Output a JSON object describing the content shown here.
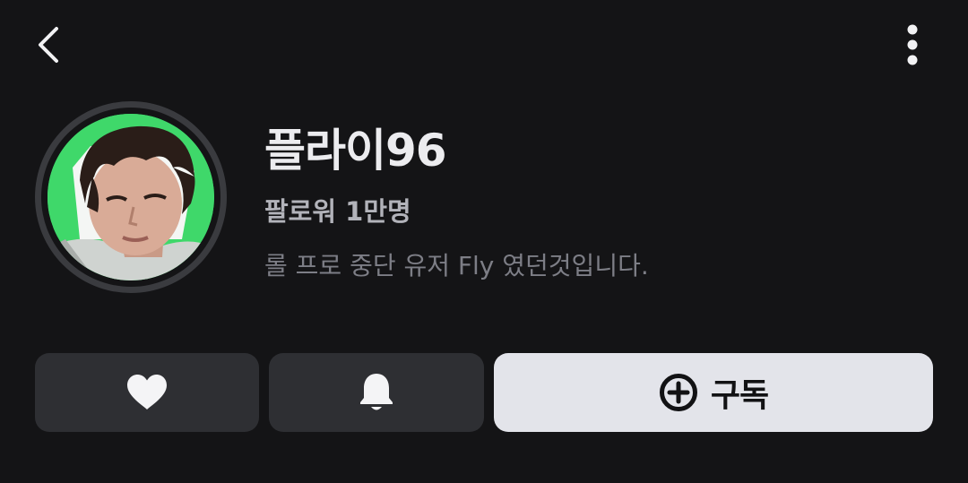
{
  "header": {
    "back_icon": "chevron-left-icon",
    "more_icon": "more-vertical-icon"
  },
  "profile": {
    "name": "플라이96",
    "followers": "팔로워 1만명",
    "description": "롤 프로 중단 유저 Fly 였던것입니다."
  },
  "actions": {
    "like_icon": "heart-icon",
    "notify_icon": "bell-icon",
    "subscribe_icon": "plus-circle-icon",
    "subscribe_label": "구독"
  },
  "colors": {
    "background": "#141416",
    "button_dark": "#2e2f33",
    "button_light": "#e3e4ea",
    "avatar_bg": "#3fd86a"
  }
}
